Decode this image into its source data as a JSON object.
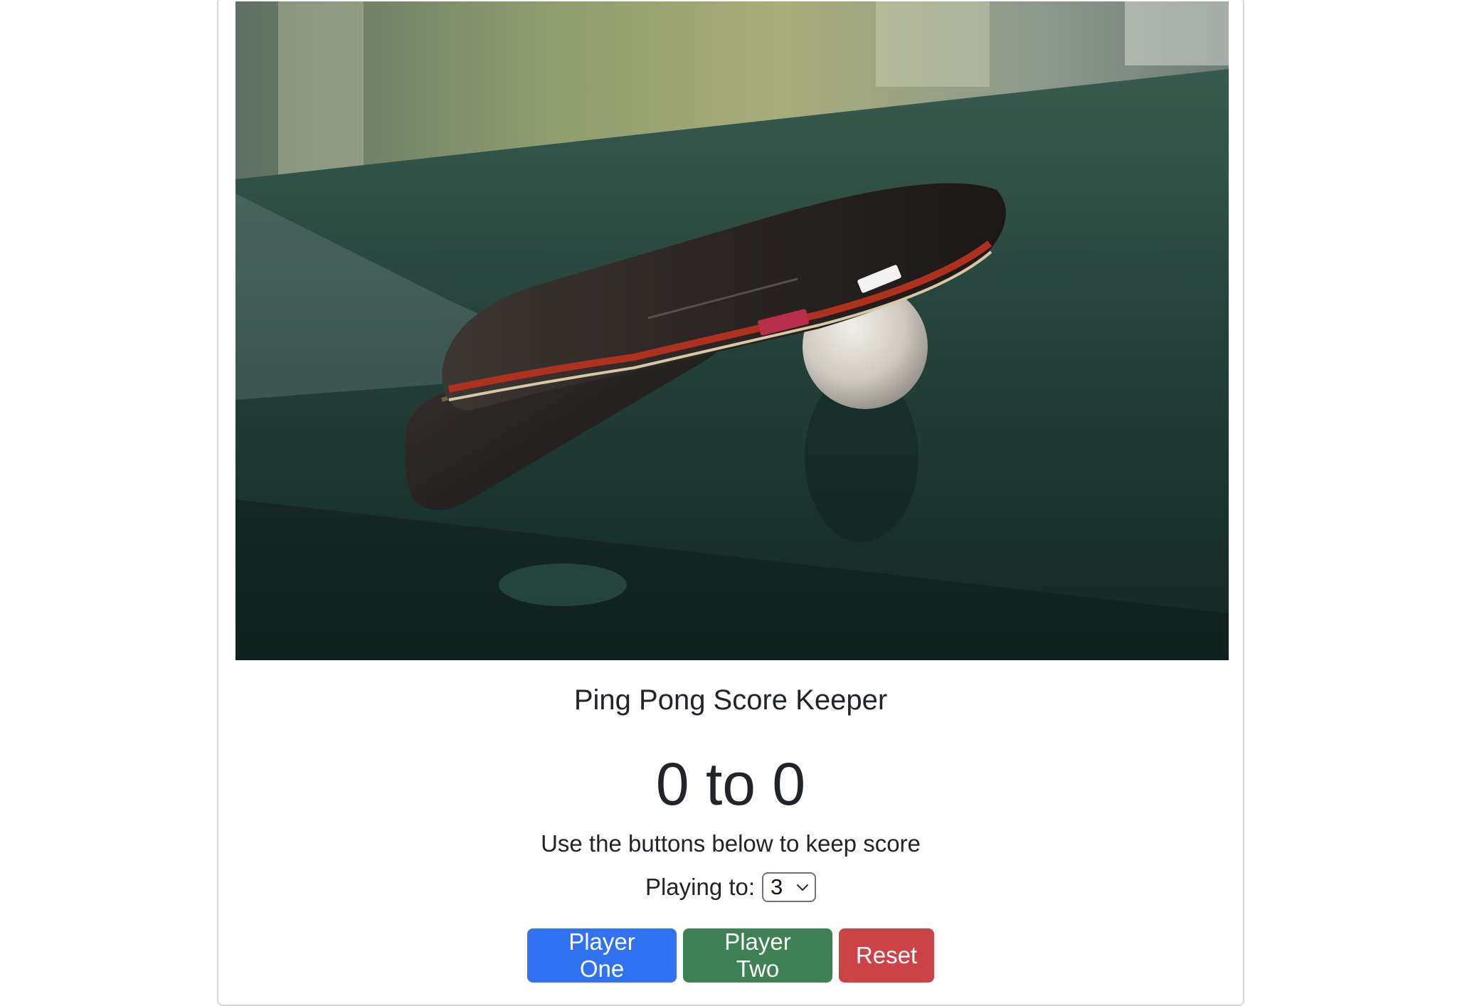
{
  "card": {
    "image_alt": "ping pong paddle and ball on a table",
    "title": "Ping Pong Score Keeper",
    "score": {
      "player_one": "0",
      "separator": "to",
      "player_two": "0",
      "display": "0 to 0"
    },
    "instructions": "Use the buttons below to keep score",
    "playing_to": {
      "label": "Playing to:",
      "selected": "3"
    },
    "buttons": {
      "player_one": "Player One",
      "player_two": "Player Two",
      "reset": "Reset"
    }
  },
  "colors": {
    "player_one_button": "#3072f1",
    "player_two_button": "#3e8154",
    "reset_button": "#cc4347",
    "text": "#212529",
    "card_border": "#d5d7da"
  },
  "icons": {
    "select_arrow": "chevron-down-icon"
  }
}
